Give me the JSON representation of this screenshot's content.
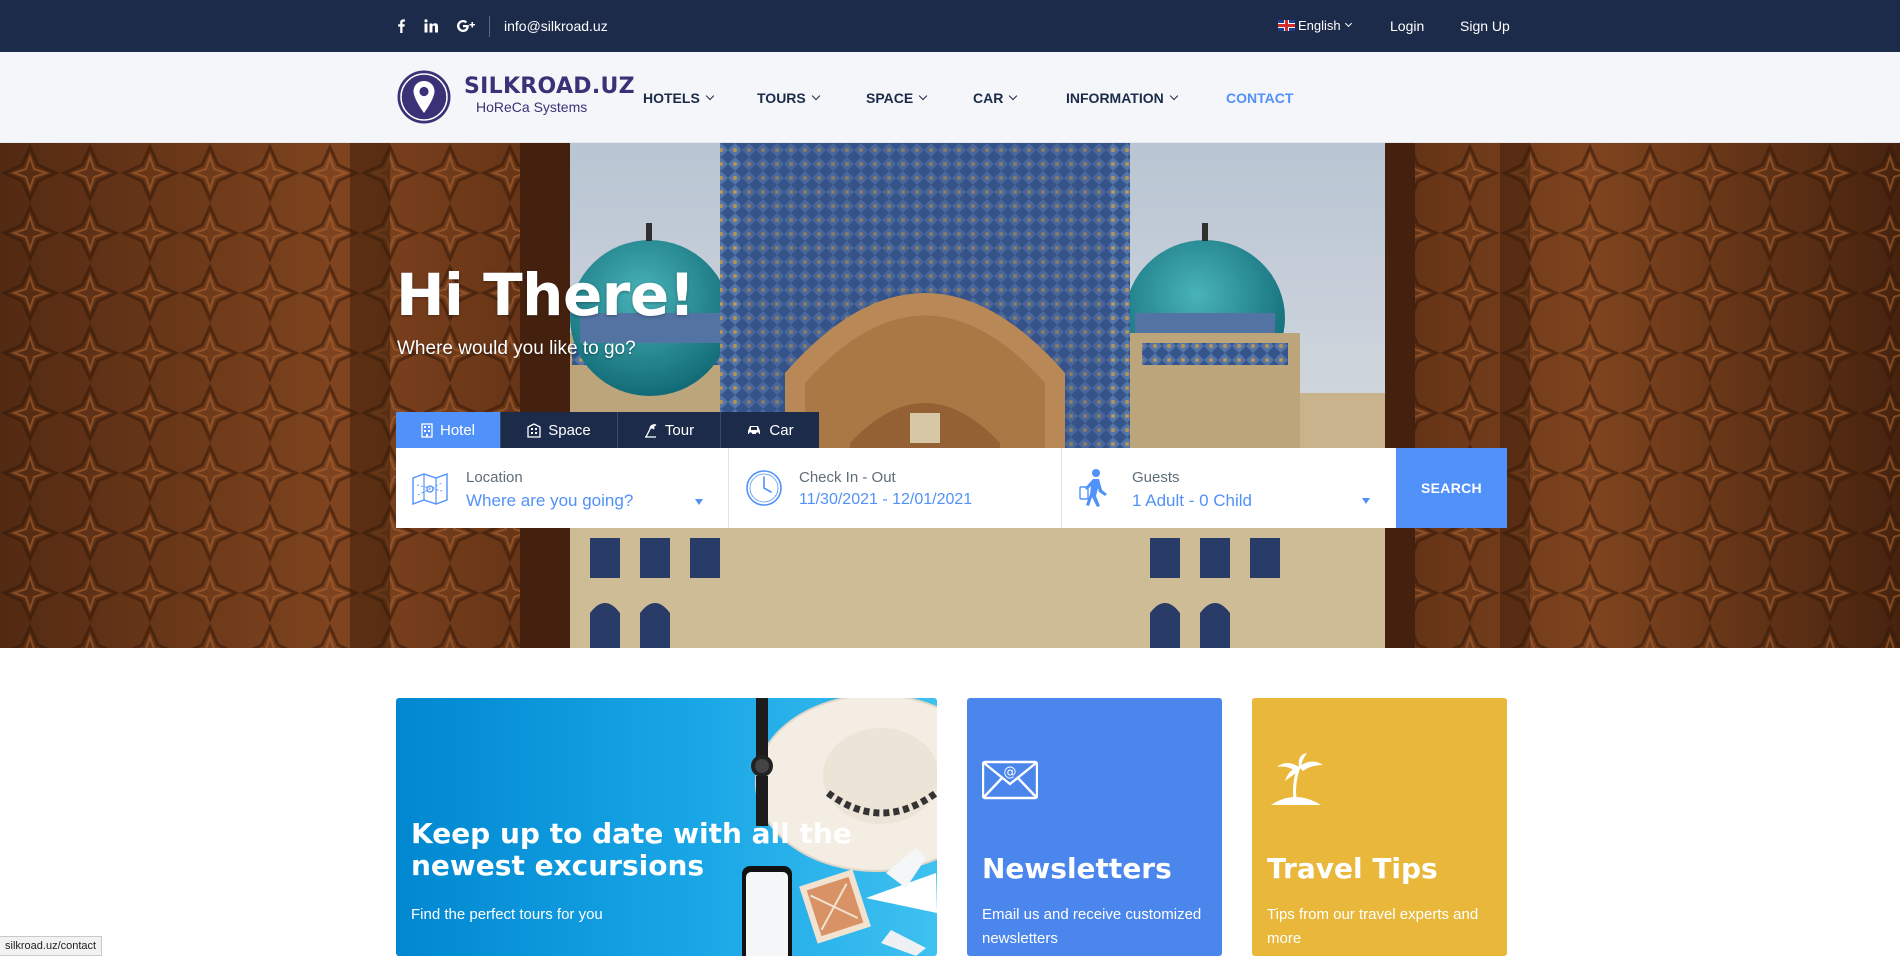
{
  "topbar": {
    "social": [
      "facebook-icon",
      "linkedin-icon",
      "google-plus-icon"
    ],
    "email": "info@silkroad.uz",
    "language": "English",
    "login": "Login",
    "signup": "Sign Up"
  },
  "header": {
    "logo_name": "SILKROAD.UZ",
    "logo_sub": "HoReCa Systems",
    "nav": [
      {
        "label": "HOTELS"
      },
      {
        "label": "TOURS"
      },
      {
        "label": "SPACE"
      },
      {
        "label": "CAR"
      },
      {
        "label": "INFORMATION"
      },
      {
        "label": "CONTACT"
      }
    ]
  },
  "hero": {
    "title": "Hi There!",
    "subtitle": "Where would you like to go?",
    "tabs": [
      {
        "label": "Hotel",
        "icon": "hotel-icon"
      },
      {
        "label": "Space",
        "icon": "building-icon"
      },
      {
        "label": "Tour",
        "icon": "tour-icon"
      },
      {
        "label": "Car",
        "icon": "car-icon"
      }
    ],
    "search": {
      "location_label": "Location",
      "location_placeholder": "Where are you going?",
      "dates_label": "Check In - Out",
      "dates_value": "11/30/2021 - 12/01/2021",
      "guests_label": "Guests",
      "guests_value": "1 Adult - 0 Child",
      "button": "SEARCH"
    }
  },
  "cards": [
    {
      "title": "Keep up to date with all the newest excursions",
      "text": "Find the perfect tours for you"
    },
    {
      "title": "Newsletters",
      "text": "Email us and receive customized newsletters",
      "icon": "envelope-icon"
    },
    {
      "title": "Travel Tips",
      "text": "Tips from our travel experts and more",
      "icon": "palm-island-icon"
    }
  ],
  "status_url": "silkroad.uz/contact",
  "colors": {
    "navy": "#1b2b49",
    "accent": "#5191fa",
    "newsletter": "#4a86ec",
    "tips": "#e9b83a"
  }
}
